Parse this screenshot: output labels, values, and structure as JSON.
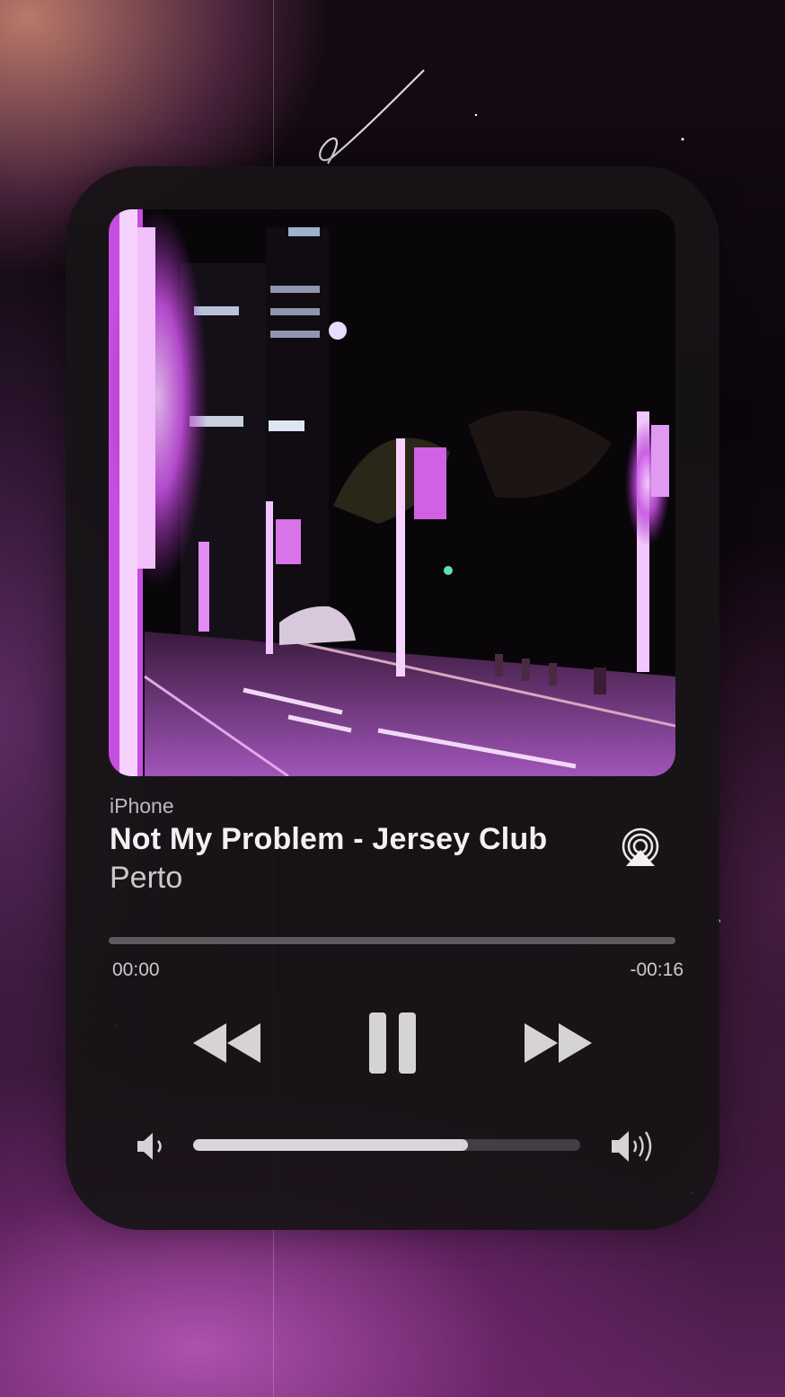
{
  "now_playing": {
    "source": "iPhone",
    "title": "Not My Problem - Jersey Club",
    "artist": "Perto"
  },
  "playback": {
    "elapsed": "00:00",
    "remaining": "-00:16",
    "progress_fraction": 0.0
  },
  "controls": {
    "rewind_icon": "rewind-icon",
    "pause_icon": "pause-icon",
    "forward_icon": "fast-forward-icon",
    "airplay_icon": "airplay-icon"
  },
  "volume": {
    "level_fraction": 0.71,
    "low_icon": "volume-low-icon",
    "high_icon": "volume-high-icon"
  },
  "colors": {
    "accent_purple": "#c060d8",
    "card_background": "#171316",
    "control_gray": "#d6d3d6"
  }
}
